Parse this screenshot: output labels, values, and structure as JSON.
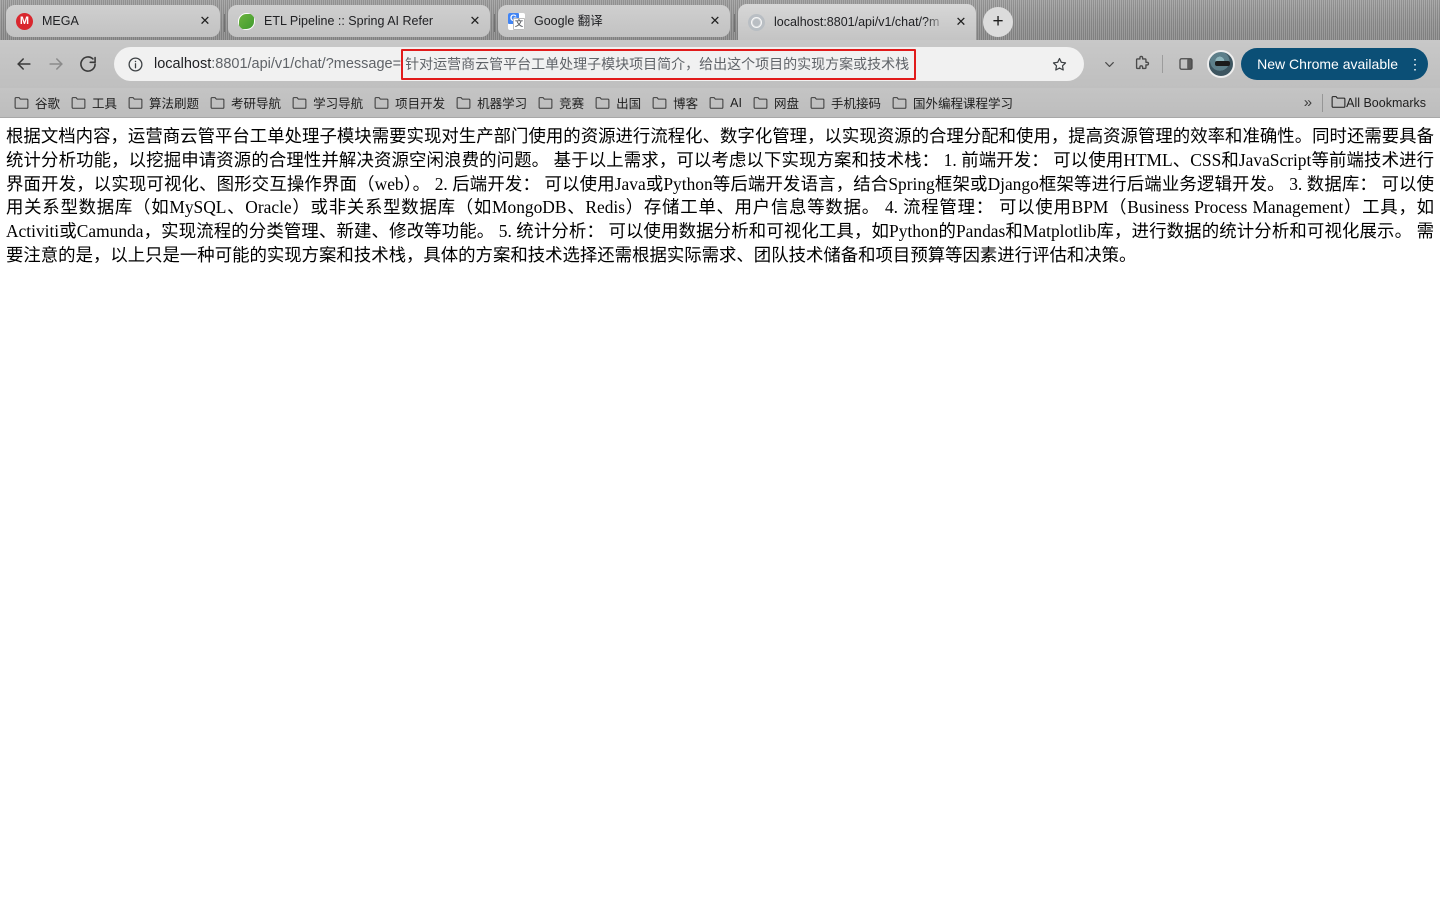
{
  "window": {
    "browser": "Google Chrome"
  },
  "tabs": [
    {
      "title": "MEGA",
      "favicon": "mega-icon",
      "active": false,
      "close_label": "✕"
    },
    {
      "title": "ETL Pipeline :: Spring AI Refer",
      "favicon": "spring-leaf-icon",
      "active": false,
      "close_label": "✕"
    },
    {
      "title": "Google 翻译",
      "favicon": "google-translate-icon",
      "active": false,
      "close_label": "✕"
    },
    {
      "title": "localhost:8801/api/v1/chat/?m",
      "favicon": "globe-icon",
      "active": true,
      "close_label": "✕"
    }
  ],
  "new_tab_button": {
    "label": "+",
    "name": "new-tab-button"
  },
  "toolbar": {
    "back_label": "←",
    "forward_label": "→",
    "reload_label": "↻",
    "site_info_icon": "info-circle-icon",
    "url": {
      "host": "localhost",
      "path": ":8801/api/v1/chat/?message=",
      "query": "针对运营商云管平台工单处理子模块项目简介，给出这个项目的实现方案或技术栈",
      "full": "localhost:8801/api/v1/chat/?message=针对运营商云管平台工单处理子模块项目简介，给出这个项目的实现方案或技术栈",
      "highlight_color": "#e11b1b"
    },
    "bookmark_star_icon": "star-icon",
    "chevron_icon": "chevron-down-icon",
    "extensions_icon": "puzzle-piece-icon",
    "side_panel_icon": "side-panel-icon",
    "avatar_icon": "profile-avatar",
    "update_button": {
      "label": "New Chrome available",
      "menu_label": "⋮",
      "color": "#0b4f76"
    }
  },
  "bookmarks_bar": {
    "items": [
      {
        "label": "谷歌"
      },
      {
        "label": "工具"
      },
      {
        "label": "算法刷题"
      },
      {
        "label": "考研导航"
      },
      {
        "label": "学习导航"
      },
      {
        "label": "项目开发"
      },
      {
        "label": "机器学习"
      },
      {
        "label": "竞赛"
      },
      {
        "label": "出国"
      },
      {
        "label": "博客"
      },
      {
        "label": "AI"
      },
      {
        "label": "网盘"
      },
      {
        "label": "手机接码"
      },
      {
        "label": "国外编程课程学习"
      }
    ],
    "overflow_label": "»",
    "all_bookmarks_label": "All Bookmarks"
  },
  "page_content": {
    "body_text": "根据文档内容，运营商云管平台工单处理子模块需要实现对生产部门使用的资源进行流程化、数字化管理，以实现资源的合理分配和使用，提高资源管理的效率和准确性。同时还需要具备统计分析功能，以挖掘申请资源的合理性并解决资源空闲浪费的问题。 基于以上需求，可以考虑以下实现方案和技术栈： 1. 前端开发： 可以使用HTML、CSS和JavaScript等前端技术进行界面开发，以实现可视化、图形交互操作界面（web）。 2. 后端开发： 可以使用Java或Python等后端开发语言，结合Spring框架或Django框架等进行后端业务逻辑开发。 3. 数据库： 可以使用关系型数据库（如MySQL、Oracle）或非关系型数据库（如MongoDB、Redis）存储工单、用户信息等数据。 4. 流程管理： 可以使用BPM（Business Process Management）工具，如Activiti或Camunda，实现流程的分类管理、新建、修改等功能。 5. 统计分析： 可以使用数据分析和可视化工具，如Python的Pandas和Matplotlib库，进行数据的统计分析和可视化展示。 需要注意的是，以上只是一种可能的实现方案和技术栈，具体的方案和技术选择还需根据实际需求、团队技术储备和项目预算等因素进行评估和决策。"
  }
}
